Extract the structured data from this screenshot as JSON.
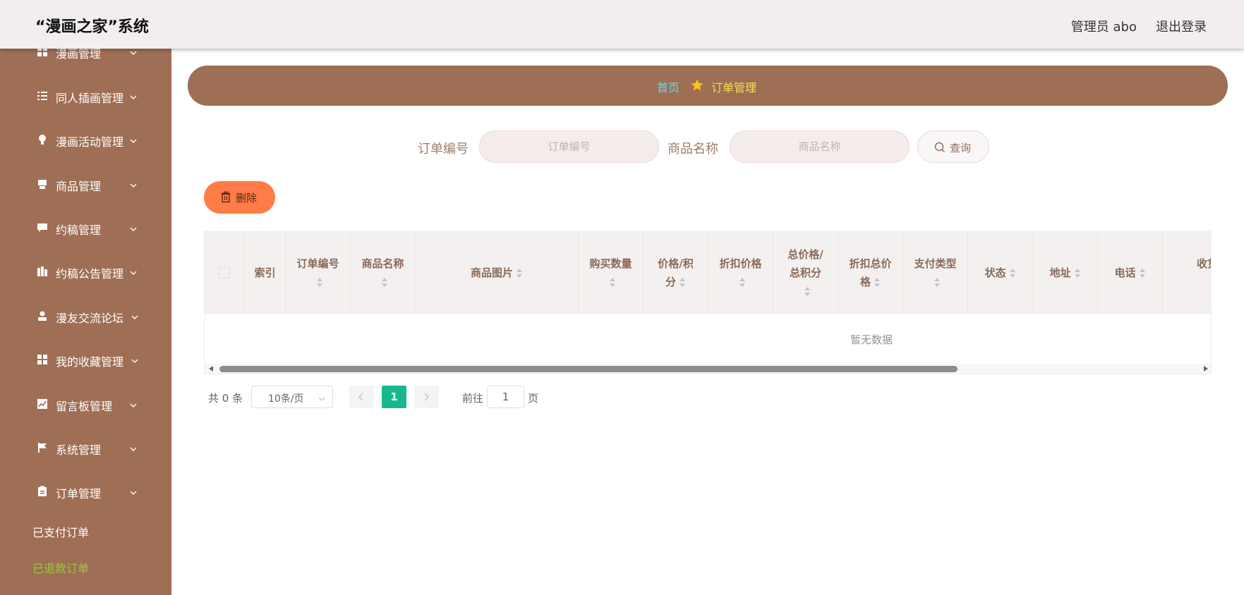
{
  "header": {
    "title": "“漫画之家”系统",
    "user": "管理员 abo",
    "logout": "退出登录"
  },
  "sidebar": {
    "items": [
      {
        "label": "漫画管理",
        "icon": "grid-icon"
      },
      {
        "label": "同人插画管理",
        "icon": "list-icon"
      },
      {
        "label": "漫画活动管理",
        "icon": "bulb-icon"
      },
      {
        "label": "商品管理",
        "icon": "printer-icon"
      },
      {
        "label": "约稿管理",
        "icon": "message-icon"
      },
      {
        "label": "约稿公告管理",
        "icon": "office-icon"
      },
      {
        "label": "漫友交流论坛",
        "icon": "user-icon"
      },
      {
        "label": "我的收藏管理",
        "icon": "grid-icon"
      },
      {
        "label": "留言板管理",
        "icon": "chart-icon"
      },
      {
        "label": "系统管理",
        "icon": "flag-icon"
      },
      {
        "label": "订单管理",
        "icon": "clipboard-icon"
      }
    ],
    "sub_items": [
      {
        "label": "已支付订单",
        "color": "#ffffff"
      },
      {
        "label": "已退款订单",
        "color": "#9acd32"
      }
    ]
  },
  "breadcrumb": {
    "home": "首页",
    "current": "订单管理"
  },
  "search": {
    "order_label": "订单编号",
    "order_placeholder": "订单编号",
    "product_label": "商品名称",
    "product_placeholder": "商品名称",
    "query_button": "查询"
  },
  "actions": {
    "delete_button": "删除"
  },
  "table": {
    "columns": [
      {
        "label": "",
        "type": "checkbox"
      },
      {
        "label": "索引"
      },
      {
        "label": "订单编号",
        "sortable": true
      },
      {
        "label": "商品名称",
        "sortable": true
      },
      {
        "label": "商品图片",
        "sortable": true
      },
      {
        "label": "购买数量",
        "sortable": true
      },
      {
        "label": "价格/积分",
        "sortable": true
      },
      {
        "label": "折扣价格",
        "sortable": true
      },
      {
        "label": "总价格/总积分",
        "sortable": true
      },
      {
        "label": "折扣总价格",
        "sortable": true
      },
      {
        "label": "支付类型",
        "sortable": true
      },
      {
        "label": "状态",
        "sortable": true
      },
      {
        "label": "地址",
        "sortable": true
      },
      {
        "label": "电话",
        "sortable": true
      },
      {
        "label": "收货人",
        "sortable": true
      }
    ],
    "rows": [],
    "empty_text": "暂无数据"
  },
  "pagination": {
    "total_text": "共 0 条",
    "page_size": "10条/页",
    "current_page": "1",
    "goto_label": "前往",
    "goto_value": "1",
    "page_suffix": "页"
  },
  "colors": {
    "sidebar_bg": "#9e6e55",
    "header_bg": "#f3eeee",
    "delete_btn": "#ff7b47",
    "active_page": "#18b88f",
    "breadcrumb_home": "#5ee0f0",
    "breadcrumb_current": "#f5e04f"
  }
}
